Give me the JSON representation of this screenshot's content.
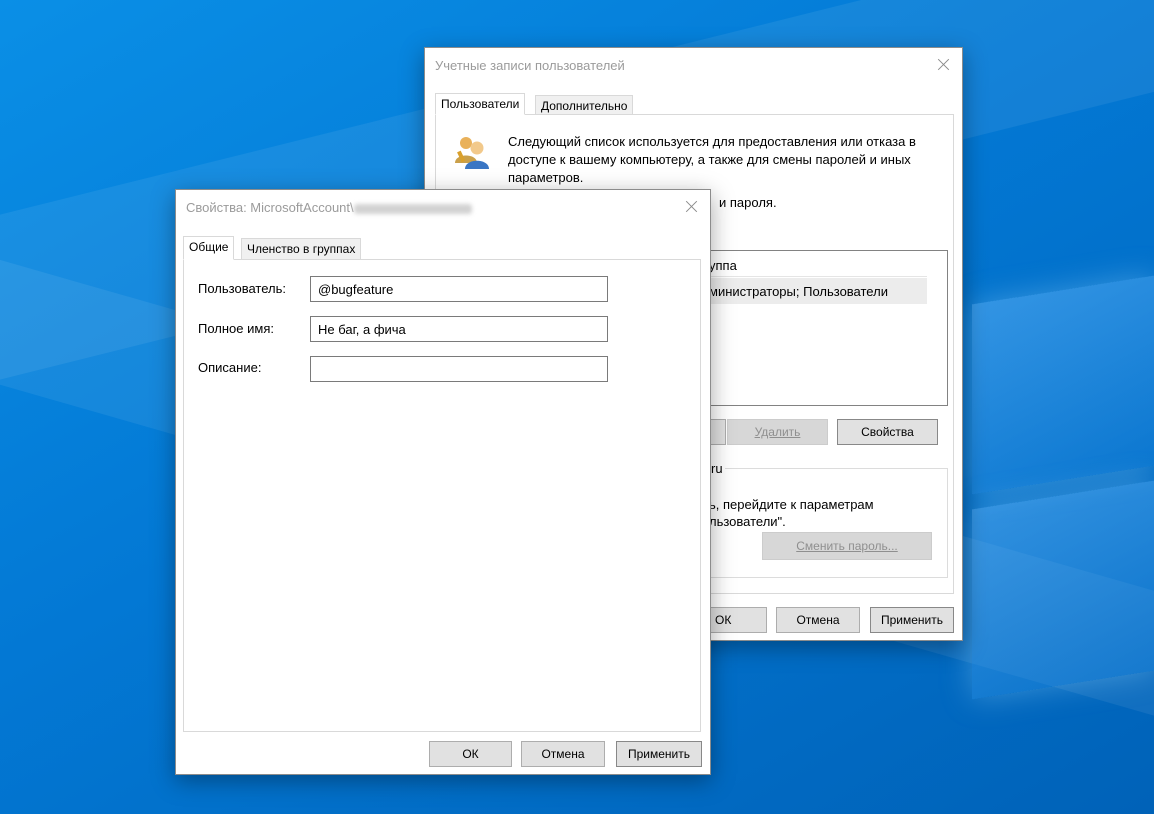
{
  "back_window": {
    "title": "Учетные записи пользователей",
    "tabs": [
      {
        "label": "Пользователи"
      },
      {
        "label": "Дополнительно"
      }
    ],
    "description": "Следующий список используется для предоставления или отказа в доступе к вашему компьютеру, а также для смены паролей и иных параметров.",
    "partial_text_passwords": "и пароля.",
    "list_header_fragment": "уппа",
    "list_row_fragment": "министраторы; Пользователи",
    "buttons": {
      "hidden_fragment": "",
      "delete": "Удалить",
      "properties": "Свойства"
    },
    "group_fragment": "ru",
    "group_text_line1": "ь, перейдите к параметрам",
    "group_text_line2": "льзователи\".",
    "change_password": "Сменить пароль...",
    "footer": {
      "ok": "ОК",
      "cancel": "Отмена",
      "apply": "Применить"
    }
  },
  "front_window": {
    "title": "Свойства: MicrosoftAccount\\",
    "tabs": [
      {
        "label": "Общие"
      },
      {
        "label": "Членство в группах"
      }
    ],
    "fields": {
      "user_label": "Пользователь:",
      "user_value": "@bugfeature",
      "fullname_label": "Полное имя:",
      "fullname_value": "Не баг, а фича",
      "description_label": "Описание:",
      "description_value": ""
    },
    "footer": {
      "ok": "ОК",
      "cancel": "Отмена",
      "apply": "Применить"
    }
  },
  "colors": {
    "desktop_blue": "#0378d4",
    "window_bg": "#ffffff",
    "button_bg": "#e1e1e1"
  },
  "icons": {
    "users": "users-icon",
    "close": "close-icon"
  }
}
